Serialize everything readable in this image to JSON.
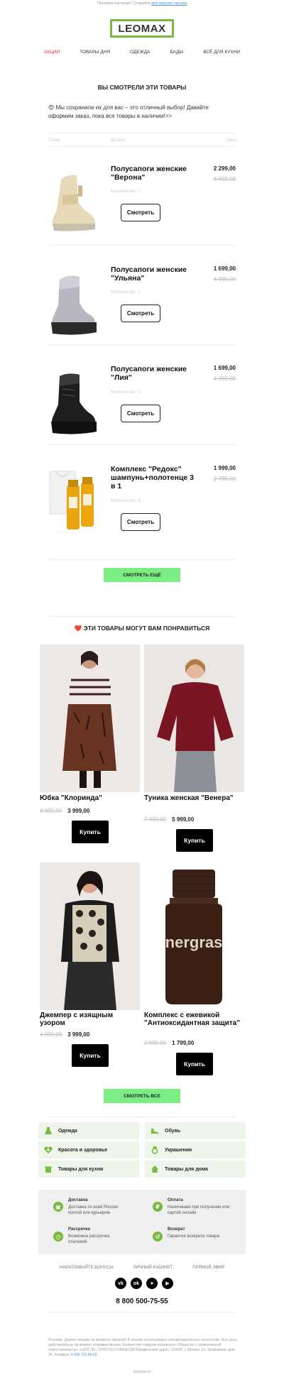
{
  "preheader": {
    "text": "Пропали картинки? Откройте ",
    "link": "веб-версию письма"
  },
  "logo": "LEOMAX",
  "nav": [
    "АКЦИИ",
    "ТОВАРЫ ДНЯ",
    "ОДЕЖДА",
    "БАДЫ",
    "ВСЁ ДЛЯ КУХНИ"
  ],
  "viewed": {
    "title": "ВЫ СМОТРЕЛИ ЭТИ ТОВАРЫ",
    "intro": "😍 Мы сохранили их для вас – это отличный выбор! Давайте оформим заказ, пока все товары в наличии!>>",
    "col_goods": "Товар",
    "col_details": "Детали",
    "col_price": "Цена",
    "items": [
      {
        "name": "Полусапоги женские \"Верона\"",
        "qty": "Количество: 1",
        "price": "2 299,00",
        "old": "6 899,00",
        "btn": "Смотреть"
      },
      {
        "name": "Полусапоги женские \"Ульяна\"",
        "qty": "Количество: 1",
        "price": "1 699,00",
        "old": "4 999,00",
        "btn": "Смотреть"
      },
      {
        "name": "Полусапоги женские \"Лия\"",
        "qty": "Количество: 1",
        "price": "1 699,00",
        "old": "4 399,00",
        "btn": "Смотреть"
      },
      {
        "name": "Комплекс \"Редокс\" шампунь+полотенце 3 в 1",
        "qty": "Количество: 1",
        "price": "1 999,00",
        "old": "2 799,00",
        "btn": "Смотреть"
      }
    ],
    "more": "СМОТРЕТЬ ЕЩЁ"
  },
  "recommend": {
    "title": "❤️ ЭТИ ТОВАРЫ МОГУТ ВАМ ПОНРАВИТЬСЯ",
    "items": [
      {
        "name": "Юбка \"Клоринда\"",
        "old": "4 999,00",
        "price": "3 999,00",
        "btn": "Купить"
      },
      {
        "name": "Туника женская \"Венера\"",
        "old": "7 499,00",
        "price": "5 999,00",
        "btn": "Купить"
      },
      {
        "name": "Джемпер с изящным узором",
        "old": "4 999,00",
        "price": "3 999,00",
        "btn": "Купить"
      },
      {
        "name": "Комплекс с ежевикой \"Антиоксидантная защита\"",
        "old": "2 999,00",
        "price": "1 799,00",
        "btn": "Купить"
      }
    ],
    "bottle_label": "nergras",
    "all": "СМОТРЕТЬ ВСЕ"
  },
  "categories": [
    "Одежда",
    "Обувь",
    "Красота и здоровье",
    "Украшения",
    "Товары для кухни",
    "Товары для дома"
  ],
  "info": [
    {
      "title": "Доставка",
      "text": "Доставка по всей России почтой или курьером"
    },
    {
      "title": "Оплата",
      "text": "Наличными при получении или картой онлайн"
    },
    {
      "title": "Рассрочка",
      "text": "Возможна рассрочка платежей"
    },
    {
      "title": "Возврат",
      "text": "Гарантия возврата товара"
    }
  ],
  "footer_links": [
    "НАКАПЛИВАЙТЕ БОНУСЫ",
    "ЛИЧНЫЙ КАБИНЕТ",
    "ПРЯМОЙ ЭФИР"
  ],
  "phone": "8 800 500-75-55",
  "legal": "Реклама. Данное письмо не является офертой. В письме использованы рекомендательные технологии. Все цены действительны на момент отправки письма. Количество товаров ограничено. Общество с ограниченной ответственностью «ЦОП ТВ», ОГРН 5117746036128 Юридический адрес: 119435, г. Москва, ул. Трофимова, дом 24. Телефон: ",
  "legal_phone": "8 495 733-96-03",
  "site": "leomax.ru",
  "colors": {
    "accent_green": "#7ab941",
    "button_green": "#7cec84",
    "nav_red": "#d6312a"
  }
}
